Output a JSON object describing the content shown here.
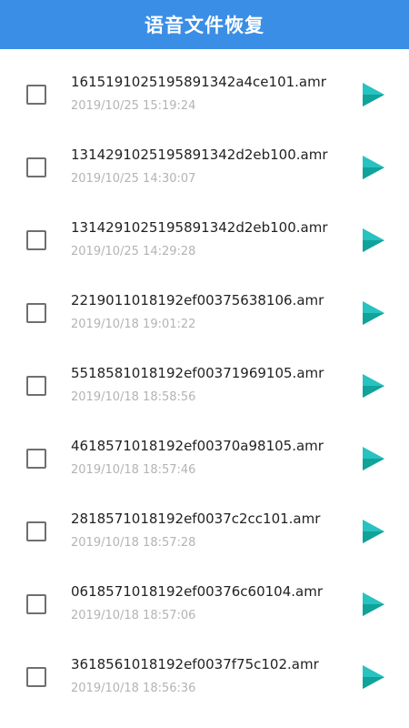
{
  "header": {
    "title": "语音文件恢复"
  },
  "colors": {
    "header_bg": "#3a8ee6",
    "play_dark": "#0fa39a",
    "play_light": "#28c2c0"
  },
  "icons": {
    "checkbox": "checkbox-icon",
    "play": "play-icon"
  },
  "files": [
    {
      "name": "1615191025195891342a4ce101.amr",
      "time": "2019/10/25 15:19:24"
    },
    {
      "name": "1314291025195891342d2eb100.amr",
      "time": "2019/10/25 14:30:07"
    },
    {
      "name": "1314291025195891342d2eb100.amr",
      "time": "2019/10/25 14:29:28"
    },
    {
      "name": "2219011018192ef00375638106.amr",
      "time": "2019/10/18 19:01:22"
    },
    {
      "name": "5518581018192ef00371969105.amr",
      "time": "2019/10/18 18:58:56"
    },
    {
      "name": "4618571018192ef00370a98105.amr",
      "time": "2019/10/18 18:57:46"
    },
    {
      "name": "2818571018192ef0037c2cc101.amr",
      "time": "2019/10/18 18:57:28"
    },
    {
      "name": "0618571018192ef00376c60104.amr",
      "time": "2019/10/18 18:57:06"
    },
    {
      "name": "3618561018192ef0037f75c102.amr",
      "time": "2019/10/18 18:56:36"
    }
  ]
}
